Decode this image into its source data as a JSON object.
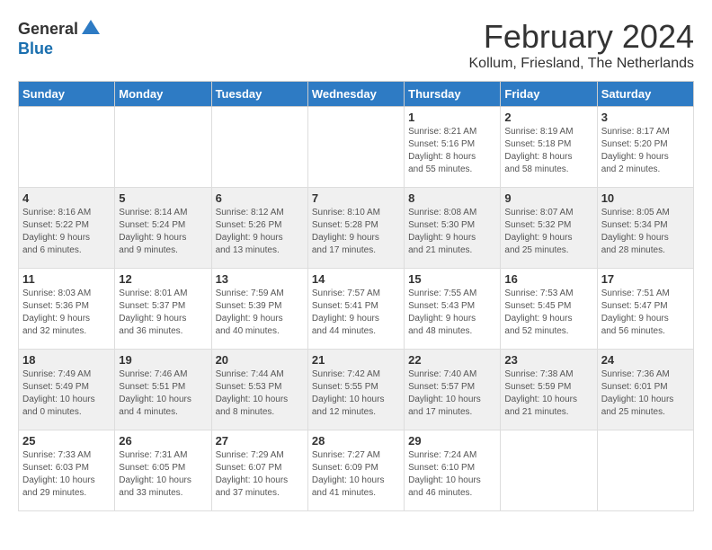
{
  "logo": {
    "general": "General",
    "blue": "Blue"
  },
  "title": "February 2024",
  "location": "Kollum, Friesland, The Netherlands",
  "days_of_week": [
    "Sunday",
    "Monday",
    "Tuesday",
    "Wednesday",
    "Thursday",
    "Friday",
    "Saturday"
  ],
  "weeks": [
    [
      {
        "day": "",
        "info": ""
      },
      {
        "day": "",
        "info": ""
      },
      {
        "day": "",
        "info": ""
      },
      {
        "day": "",
        "info": ""
      },
      {
        "day": "1",
        "info": "Sunrise: 8:21 AM\nSunset: 5:16 PM\nDaylight: 8 hours\nand 55 minutes."
      },
      {
        "day": "2",
        "info": "Sunrise: 8:19 AM\nSunset: 5:18 PM\nDaylight: 8 hours\nand 58 minutes."
      },
      {
        "day": "3",
        "info": "Sunrise: 8:17 AM\nSunset: 5:20 PM\nDaylight: 9 hours\nand 2 minutes."
      }
    ],
    [
      {
        "day": "4",
        "info": "Sunrise: 8:16 AM\nSunset: 5:22 PM\nDaylight: 9 hours\nand 6 minutes."
      },
      {
        "day": "5",
        "info": "Sunrise: 8:14 AM\nSunset: 5:24 PM\nDaylight: 9 hours\nand 9 minutes."
      },
      {
        "day": "6",
        "info": "Sunrise: 8:12 AM\nSunset: 5:26 PM\nDaylight: 9 hours\nand 13 minutes."
      },
      {
        "day": "7",
        "info": "Sunrise: 8:10 AM\nSunset: 5:28 PM\nDaylight: 9 hours\nand 17 minutes."
      },
      {
        "day": "8",
        "info": "Sunrise: 8:08 AM\nSunset: 5:30 PM\nDaylight: 9 hours\nand 21 minutes."
      },
      {
        "day": "9",
        "info": "Sunrise: 8:07 AM\nSunset: 5:32 PM\nDaylight: 9 hours\nand 25 minutes."
      },
      {
        "day": "10",
        "info": "Sunrise: 8:05 AM\nSunset: 5:34 PM\nDaylight: 9 hours\nand 28 minutes."
      }
    ],
    [
      {
        "day": "11",
        "info": "Sunrise: 8:03 AM\nSunset: 5:36 PM\nDaylight: 9 hours\nand 32 minutes."
      },
      {
        "day": "12",
        "info": "Sunrise: 8:01 AM\nSunset: 5:37 PM\nDaylight: 9 hours\nand 36 minutes."
      },
      {
        "day": "13",
        "info": "Sunrise: 7:59 AM\nSunset: 5:39 PM\nDaylight: 9 hours\nand 40 minutes."
      },
      {
        "day": "14",
        "info": "Sunrise: 7:57 AM\nSunset: 5:41 PM\nDaylight: 9 hours\nand 44 minutes."
      },
      {
        "day": "15",
        "info": "Sunrise: 7:55 AM\nSunset: 5:43 PM\nDaylight: 9 hours\nand 48 minutes."
      },
      {
        "day": "16",
        "info": "Sunrise: 7:53 AM\nSunset: 5:45 PM\nDaylight: 9 hours\nand 52 minutes."
      },
      {
        "day": "17",
        "info": "Sunrise: 7:51 AM\nSunset: 5:47 PM\nDaylight: 9 hours\nand 56 minutes."
      }
    ],
    [
      {
        "day": "18",
        "info": "Sunrise: 7:49 AM\nSunset: 5:49 PM\nDaylight: 10 hours\nand 0 minutes."
      },
      {
        "day": "19",
        "info": "Sunrise: 7:46 AM\nSunset: 5:51 PM\nDaylight: 10 hours\nand 4 minutes."
      },
      {
        "day": "20",
        "info": "Sunrise: 7:44 AM\nSunset: 5:53 PM\nDaylight: 10 hours\nand 8 minutes."
      },
      {
        "day": "21",
        "info": "Sunrise: 7:42 AM\nSunset: 5:55 PM\nDaylight: 10 hours\nand 12 minutes."
      },
      {
        "day": "22",
        "info": "Sunrise: 7:40 AM\nSunset: 5:57 PM\nDaylight: 10 hours\nand 17 minutes."
      },
      {
        "day": "23",
        "info": "Sunrise: 7:38 AM\nSunset: 5:59 PM\nDaylight: 10 hours\nand 21 minutes."
      },
      {
        "day": "24",
        "info": "Sunrise: 7:36 AM\nSunset: 6:01 PM\nDaylight: 10 hours\nand 25 minutes."
      }
    ],
    [
      {
        "day": "25",
        "info": "Sunrise: 7:33 AM\nSunset: 6:03 PM\nDaylight: 10 hours\nand 29 minutes."
      },
      {
        "day": "26",
        "info": "Sunrise: 7:31 AM\nSunset: 6:05 PM\nDaylight: 10 hours\nand 33 minutes."
      },
      {
        "day": "27",
        "info": "Sunrise: 7:29 AM\nSunset: 6:07 PM\nDaylight: 10 hours\nand 37 minutes."
      },
      {
        "day": "28",
        "info": "Sunrise: 7:27 AM\nSunset: 6:09 PM\nDaylight: 10 hours\nand 41 minutes."
      },
      {
        "day": "29",
        "info": "Sunrise: 7:24 AM\nSunset: 6:10 PM\nDaylight: 10 hours\nand 46 minutes."
      },
      {
        "day": "",
        "info": ""
      },
      {
        "day": "",
        "info": ""
      }
    ]
  ]
}
